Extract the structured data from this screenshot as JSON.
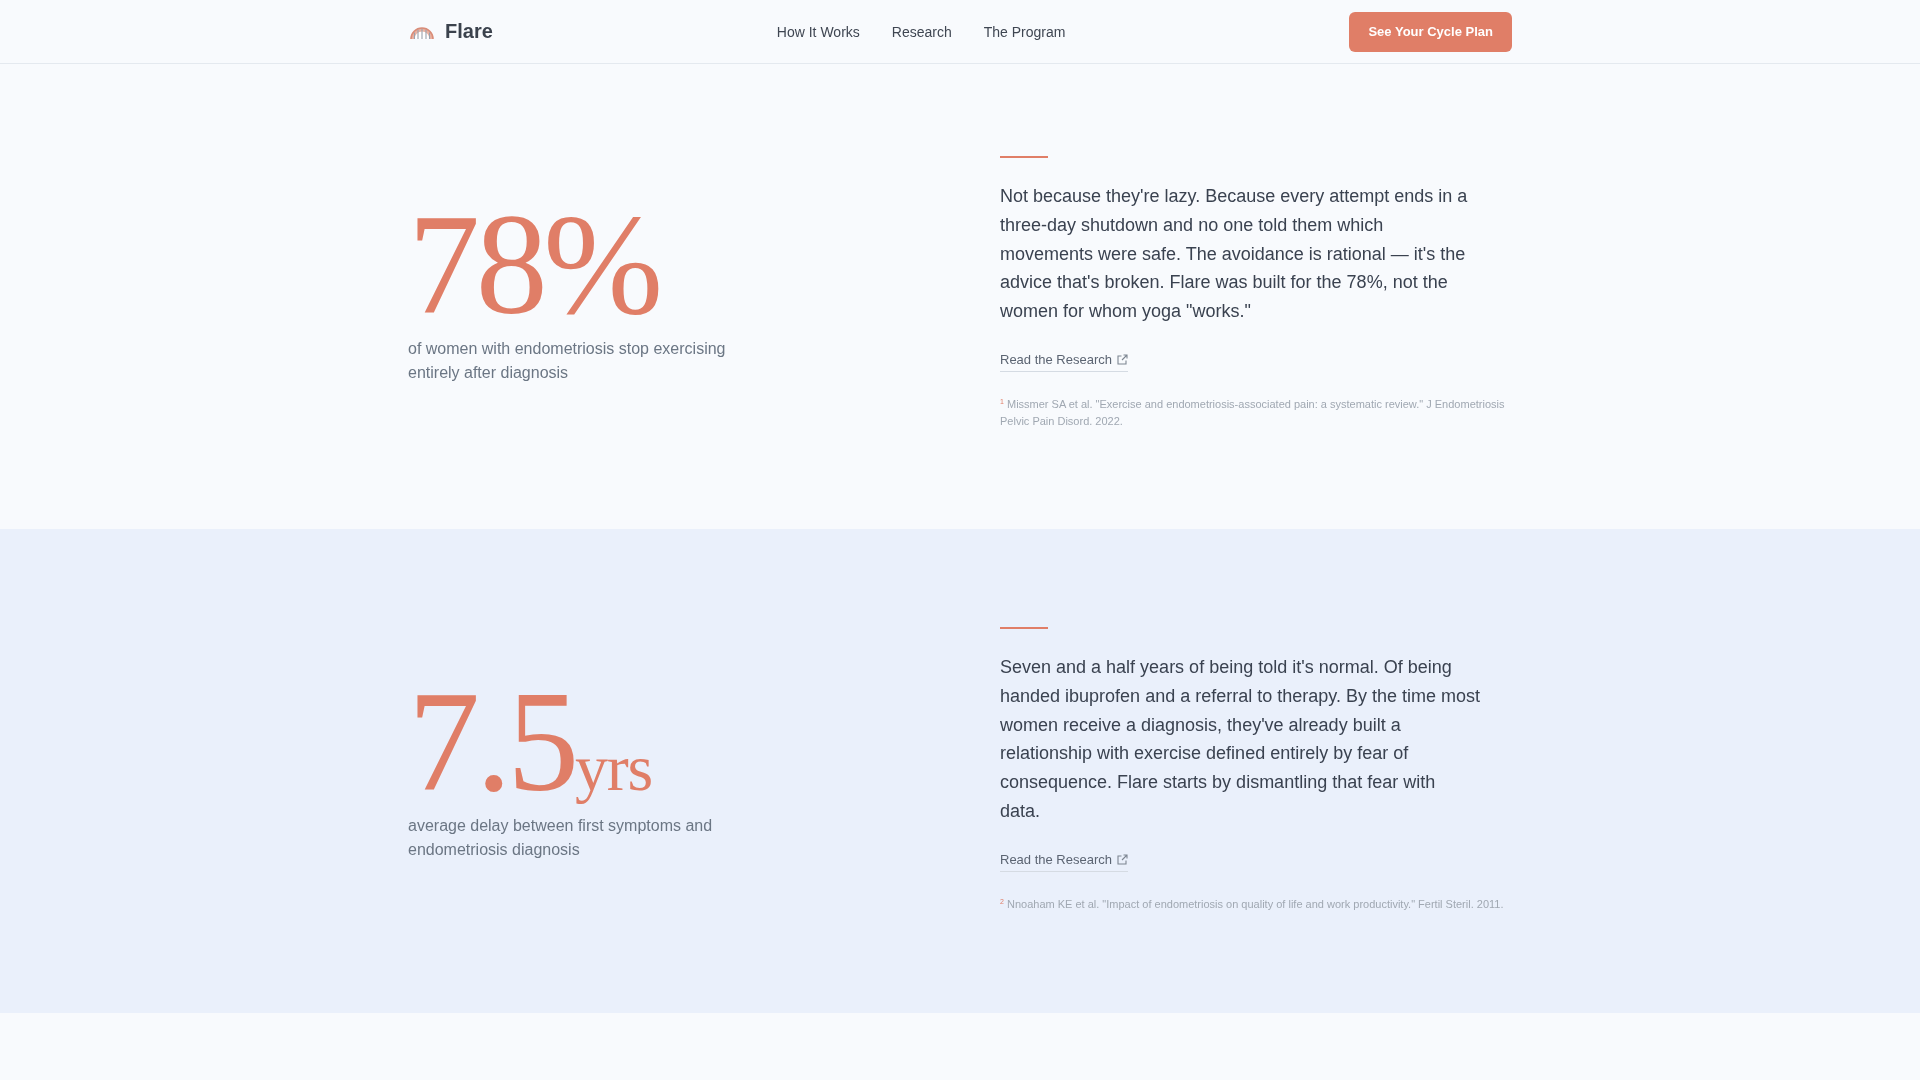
{
  "header": {
    "brand": "Flare",
    "nav": [
      "How It Works",
      "Research",
      "The Program"
    ],
    "cta": "See Your Cycle Plan"
  },
  "stats": [
    {
      "figure": "78%",
      "caption": "of women with endometriosis stop exercising entirely after diagnosis",
      "paragraph": "Not because they're lazy. Because every attempt ends in a three-day shutdown and no one told them which movements were safe. The avoidance is rational — it's the advice that's broken. Flare was built for the 78%, not the women for whom yoga \"works.\"",
      "link": "Read the Research",
      "footnote": "$^{1}$ Missmer SA et al. \"Exercise and endometriosis-associated pain: a systematic review.\" J Endometriosis Pelvic Pain Disord. 2022."
    },
    {
      "figure": "7.5",
      "unit": "yrs",
      "caption": "average delay between first symptoms and endometriosis diagnosis",
      "paragraph": "Seven and a half years of being told it's normal. Of being handed ibuprofen and a referral to therapy. By the time most women receive a diagnosis, they've already built a relationship with exercise defined entirely by fear of consequence. Flare starts by dismantling that fear with data.",
      "link": "Read the Research",
      "footnote": "$^{2}$ Nnoaham KE et al. \"Impact of endometriosis on quality of life and work productivity.\" Fertil Steril. 2011."
    }
  ]
}
